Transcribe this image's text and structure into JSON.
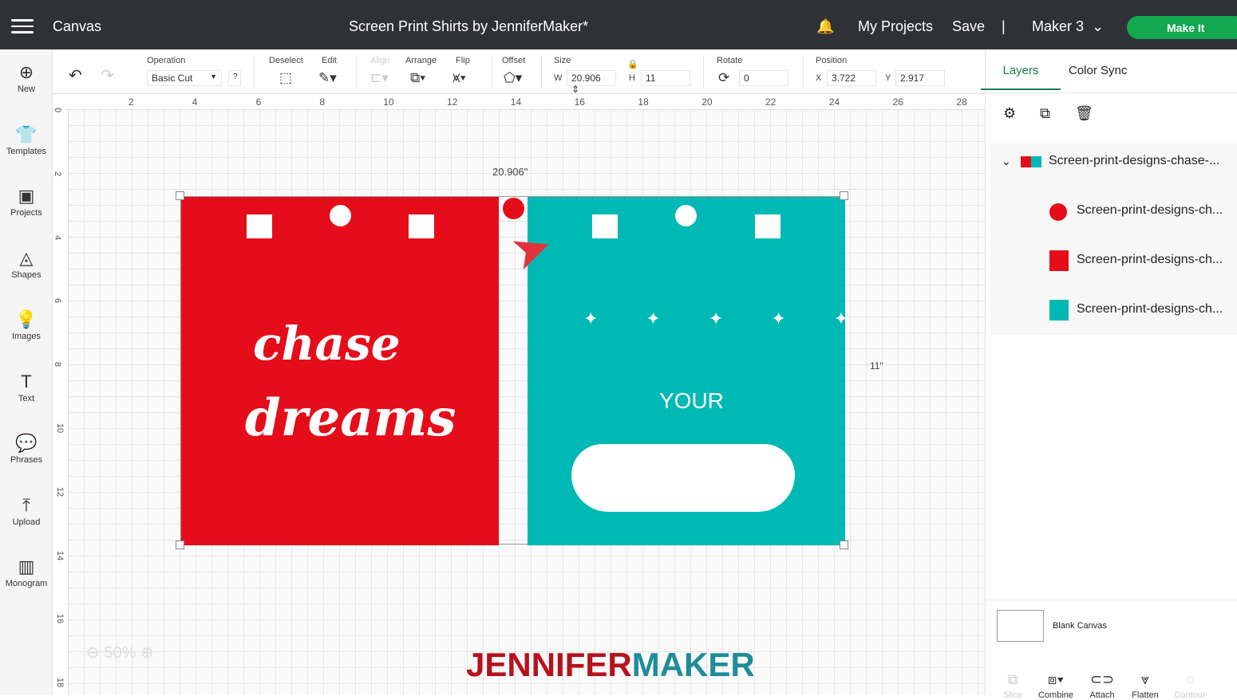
{
  "topbar": {
    "app": "Canvas",
    "title": "Screen Print Shirts by JenniferMaker*",
    "my_projects": "My Projects",
    "save": "Save",
    "divider": "|",
    "machine": "Maker 3",
    "make_it": "Make It"
  },
  "sidebar": [
    {
      "label": "New",
      "icon": "⊕"
    },
    {
      "label": "Templates",
      "icon": "👕"
    },
    {
      "label": "Projects",
      "icon": "▣"
    },
    {
      "label": "Shapes",
      "icon": "◬"
    },
    {
      "label": "Images",
      "icon": "💡"
    },
    {
      "label": "Text",
      "icon": "T"
    },
    {
      "label": "Phrases",
      "icon": "💬"
    },
    {
      "label": "Upload",
      "icon": "⤒"
    },
    {
      "label": "Monogram",
      "icon": "▥"
    }
  ],
  "toolbar": {
    "operation_label": "Operation",
    "operation_value": "Basic Cut",
    "help": "?",
    "deselect": "Deselect",
    "edit": "Edit",
    "align": "Align",
    "arrange": "Arrange",
    "flip": "Flip",
    "offset": "Offset",
    "size": "Size",
    "w_label": "W",
    "w_value": "20.906",
    "h_label": "H",
    "h_value": "11",
    "rotate": "Rotate",
    "rotate_value": "0",
    "position": "Position",
    "x_label": "X",
    "x_value": "3.722",
    "y_label": "Y",
    "y_value": "2.917"
  },
  "ruler_x": [
    "2",
    "4",
    "6",
    "8",
    "10",
    "12",
    "14",
    "16",
    "18",
    "20",
    "22",
    "24",
    "26",
    "28"
  ],
  "ruler_y": [
    "0",
    "2",
    "4",
    "6",
    "8",
    "10",
    "12",
    "14",
    "16",
    "18"
  ],
  "canvas": {
    "width_dim": "20.906\"",
    "height_dim": "11\"",
    "zoom": "50%",
    "watermark_a": "JENNIFER",
    "watermark_b": "MAKER",
    "text_chase": "chase",
    "text_dreams": "dreams",
    "text_your": "YOUR"
  },
  "colors": {
    "red": "#e50d1a",
    "teal": "#00b9b5",
    "accent": "#11a84f"
  },
  "panel": {
    "tabs": [
      "Layers",
      "Color Sync"
    ],
    "group": "Screen-print-designs-chase-...",
    "layers": [
      "Screen-print-designs-ch...",
      "Screen-print-designs-ch...",
      "Screen-print-designs-ch..."
    ],
    "blank": "Blank Canvas",
    "bottom": [
      {
        "label": "Slice",
        "enabled": false,
        "icon": "⧉"
      },
      {
        "label": "Combine",
        "enabled": true,
        "icon": "⧈▾"
      },
      {
        "label": "Attach",
        "enabled": true,
        "icon": "⊂⊃"
      },
      {
        "label": "Flatten",
        "enabled": true,
        "icon": "⩔"
      },
      {
        "label": "Contour",
        "enabled": false,
        "icon": "◌"
      }
    ]
  }
}
